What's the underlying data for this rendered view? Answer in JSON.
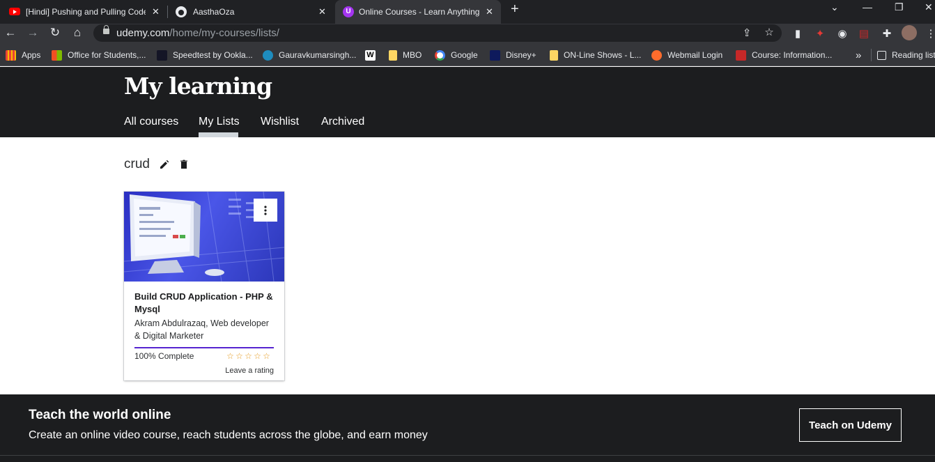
{
  "browser": {
    "tabs": [
      {
        "title": "[Hindi] Pushing and Pulling Code",
        "icon": "youtube-icon"
      },
      {
        "title": "AasthaOza",
        "icon": "github-icon"
      },
      {
        "title": "Online Courses - Learn Anything,",
        "icon": "udemy-icon",
        "active": true
      }
    ],
    "url_host": "udemy.com",
    "url_path": "/home/my-courses/lists/",
    "bookmarks": [
      {
        "label": "Apps",
        "color": "#ea4335"
      },
      {
        "label": "Office for Students,...",
        "color": "#f25022"
      },
      {
        "label": "Speedtest by Ookla...",
        "color": "#141526"
      },
      {
        "label": "Gauravkumarsingh...",
        "color": "#1e8cbe"
      },
      {
        "label": "W",
        "color": "#ffffff"
      },
      {
        "label": "MBO",
        "color": "#fdd663"
      },
      {
        "label": "Google",
        "color": "#4285f4"
      },
      {
        "label": "Disney+",
        "color": "#0e1a5c"
      },
      {
        "label": "ON-Line Shows - L...",
        "color": "#fdd663"
      },
      {
        "label": "Webmail Login",
        "color": "#ff6c2c"
      },
      {
        "label": "Course: Information...",
        "color": "#c62828"
      },
      {
        "label": "Reading list",
        "color": "#e8eaed"
      }
    ],
    "more_bookmarks": "»"
  },
  "header": {
    "title": "My learning",
    "tabs": [
      "All courses",
      "My Lists",
      "Wishlist",
      "Archived"
    ],
    "active_tab": "My Lists"
  },
  "list": {
    "name": "crud"
  },
  "course": {
    "title": "Build CRUD Application - PHP & Mysql",
    "instructor": "Akram Abdulrazaq, Web developer & Digital Marketer",
    "progress_label": "100% Complete",
    "progress": 1.0,
    "rating_stars": 5,
    "rating_cta": "Leave a rating"
  },
  "footer": {
    "title": "Teach the world online",
    "subtitle": "Create an online video course, reach students across the globe, and earn money",
    "button": "Teach on Udemy"
  },
  "colors": {
    "dark": "#1c1d1f",
    "progress": "#5624d0",
    "star": "#e59819"
  }
}
